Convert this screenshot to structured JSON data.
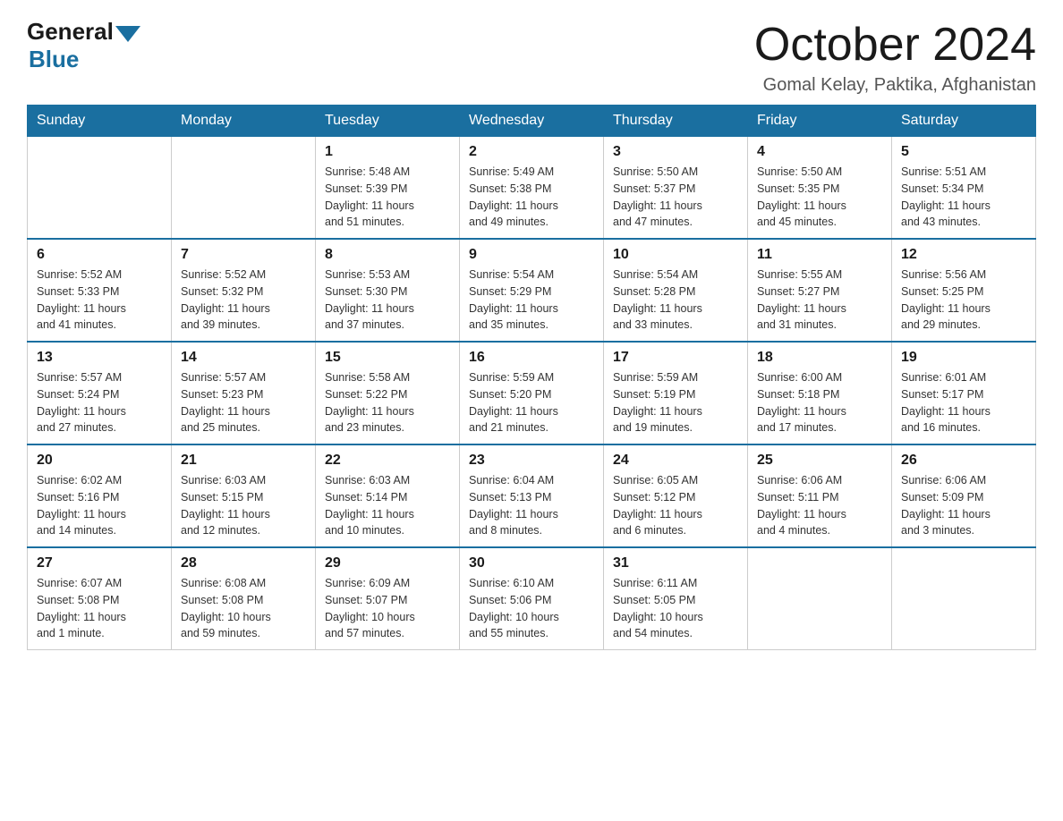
{
  "header": {
    "logo_general": "General",
    "logo_blue": "Blue",
    "month_title": "October 2024",
    "location": "Gomal Kelay, Paktika, Afghanistan"
  },
  "columns": [
    "Sunday",
    "Monday",
    "Tuesday",
    "Wednesday",
    "Thursday",
    "Friday",
    "Saturday"
  ],
  "weeks": [
    [
      {
        "day": "",
        "info": ""
      },
      {
        "day": "",
        "info": ""
      },
      {
        "day": "1",
        "info": "Sunrise: 5:48 AM\nSunset: 5:39 PM\nDaylight: 11 hours\nand 51 minutes."
      },
      {
        "day": "2",
        "info": "Sunrise: 5:49 AM\nSunset: 5:38 PM\nDaylight: 11 hours\nand 49 minutes."
      },
      {
        "day": "3",
        "info": "Sunrise: 5:50 AM\nSunset: 5:37 PM\nDaylight: 11 hours\nand 47 minutes."
      },
      {
        "day": "4",
        "info": "Sunrise: 5:50 AM\nSunset: 5:35 PM\nDaylight: 11 hours\nand 45 minutes."
      },
      {
        "day": "5",
        "info": "Sunrise: 5:51 AM\nSunset: 5:34 PM\nDaylight: 11 hours\nand 43 minutes."
      }
    ],
    [
      {
        "day": "6",
        "info": "Sunrise: 5:52 AM\nSunset: 5:33 PM\nDaylight: 11 hours\nand 41 minutes."
      },
      {
        "day": "7",
        "info": "Sunrise: 5:52 AM\nSunset: 5:32 PM\nDaylight: 11 hours\nand 39 minutes."
      },
      {
        "day": "8",
        "info": "Sunrise: 5:53 AM\nSunset: 5:30 PM\nDaylight: 11 hours\nand 37 minutes."
      },
      {
        "day": "9",
        "info": "Sunrise: 5:54 AM\nSunset: 5:29 PM\nDaylight: 11 hours\nand 35 minutes."
      },
      {
        "day": "10",
        "info": "Sunrise: 5:54 AM\nSunset: 5:28 PM\nDaylight: 11 hours\nand 33 minutes."
      },
      {
        "day": "11",
        "info": "Sunrise: 5:55 AM\nSunset: 5:27 PM\nDaylight: 11 hours\nand 31 minutes."
      },
      {
        "day": "12",
        "info": "Sunrise: 5:56 AM\nSunset: 5:25 PM\nDaylight: 11 hours\nand 29 minutes."
      }
    ],
    [
      {
        "day": "13",
        "info": "Sunrise: 5:57 AM\nSunset: 5:24 PM\nDaylight: 11 hours\nand 27 minutes."
      },
      {
        "day": "14",
        "info": "Sunrise: 5:57 AM\nSunset: 5:23 PM\nDaylight: 11 hours\nand 25 minutes."
      },
      {
        "day": "15",
        "info": "Sunrise: 5:58 AM\nSunset: 5:22 PM\nDaylight: 11 hours\nand 23 minutes."
      },
      {
        "day": "16",
        "info": "Sunrise: 5:59 AM\nSunset: 5:20 PM\nDaylight: 11 hours\nand 21 minutes."
      },
      {
        "day": "17",
        "info": "Sunrise: 5:59 AM\nSunset: 5:19 PM\nDaylight: 11 hours\nand 19 minutes."
      },
      {
        "day": "18",
        "info": "Sunrise: 6:00 AM\nSunset: 5:18 PM\nDaylight: 11 hours\nand 17 minutes."
      },
      {
        "day": "19",
        "info": "Sunrise: 6:01 AM\nSunset: 5:17 PM\nDaylight: 11 hours\nand 16 minutes."
      }
    ],
    [
      {
        "day": "20",
        "info": "Sunrise: 6:02 AM\nSunset: 5:16 PM\nDaylight: 11 hours\nand 14 minutes."
      },
      {
        "day": "21",
        "info": "Sunrise: 6:03 AM\nSunset: 5:15 PM\nDaylight: 11 hours\nand 12 minutes."
      },
      {
        "day": "22",
        "info": "Sunrise: 6:03 AM\nSunset: 5:14 PM\nDaylight: 11 hours\nand 10 minutes."
      },
      {
        "day": "23",
        "info": "Sunrise: 6:04 AM\nSunset: 5:13 PM\nDaylight: 11 hours\nand 8 minutes."
      },
      {
        "day": "24",
        "info": "Sunrise: 6:05 AM\nSunset: 5:12 PM\nDaylight: 11 hours\nand 6 minutes."
      },
      {
        "day": "25",
        "info": "Sunrise: 6:06 AM\nSunset: 5:11 PM\nDaylight: 11 hours\nand 4 minutes."
      },
      {
        "day": "26",
        "info": "Sunrise: 6:06 AM\nSunset: 5:09 PM\nDaylight: 11 hours\nand 3 minutes."
      }
    ],
    [
      {
        "day": "27",
        "info": "Sunrise: 6:07 AM\nSunset: 5:08 PM\nDaylight: 11 hours\nand 1 minute."
      },
      {
        "day": "28",
        "info": "Sunrise: 6:08 AM\nSunset: 5:08 PM\nDaylight: 10 hours\nand 59 minutes."
      },
      {
        "day": "29",
        "info": "Sunrise: 6:09 AM\nSunset: 5:07 PM\nDaylight: 10 hours\nand 57 minutes."
      },
      {
        "day": "30",
        "info": "Sunrise: 6:10 AM\nSunset: 5:06 PM\nDaylight: 10 hours\nand 55 minutes."
      },
      {
        "day": "31",
        "info": "Sunrise: 6:11 AM\nSunset: 5:05 PM\nDaylight: 10 hours\nand 54 minutes."
      },
      {
        "day": "",
        "info": ""
      },
      {
        "day": "",
        "info": ""
      }
    ]
  ]
}
